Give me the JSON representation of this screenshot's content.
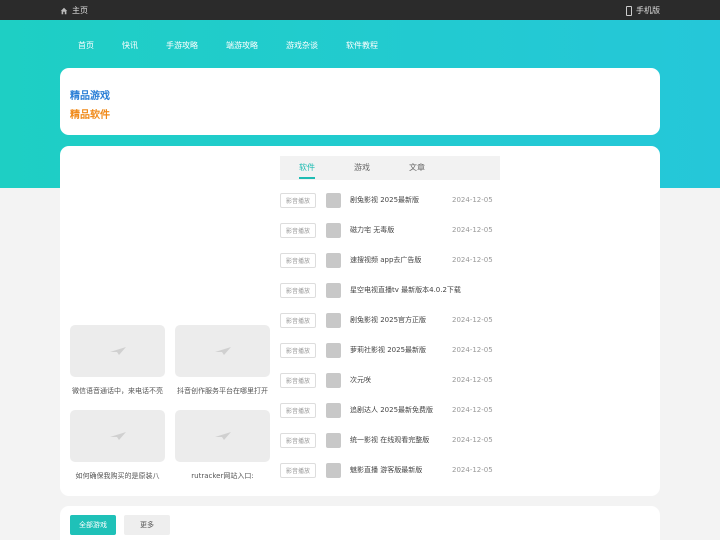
{
  "topbar": {
    "home": "主页",
    "mobile": "手机版"
  },
  "nav": [
    "首页",
    "快讯",
    "手游攻略",
    "端游攻略",
    "游戏杂谈",
    "软件教程"
  ],
  "categories": {
    "games": "精品游戏",
    "software": "精品软件"
  },
  "thumbs": [
    {
      "caption": "微信语音通话中，来电话不亮"
    },
    {
      "caption": "抖音创作服务平台在哪里打开"
    },
    {
      "caption": "如何确保我购买的是原装八"
    },
    {
      "caption": "rutracker网站入口:"
    }
  ],
  "tabs": {
    "software": "软件",
    "games": "游戏",
    "articles": "文章"
  },
  "list": [
    {
      "badge": "影音播放",
      "title": "剧兔影视 2025最新版",
      "date": "2024-12-05"
    },
    {
      "badge": "影音播放",
      "title": "磁力宅 无毒版",
      "date": "2024-12-05"
    },
    {
      "badge": "影音播放",
      "title": "速搜视频 app去广告版",
      "date": "2024-12-05"
    },
    {
      "badge": "影音播放",
      "title": "星空电视直播tv 最新版本4.0.2下载",
      "date": ""
    },
    {
      "badge": "影音播放",
      "title": "剧兔影视 2025官方正版",
      "date": "2024-12-05"
    },
    {
      "badge": "影音播放",
      "title": "萝莉社影视 2025最新版",
      "date": "2024-12-05"
    },
    {
      "badge": "影音播放",
      "title": "次元咲",
      "date": "2024-12-05"
    },
    {
      "badge": "影音播放",
      "title": "追剧达人 2025最新免费版",
      "date": "2024-12-05"
    },
    {
      "badge": "影音播放",
      "title": "统一影视 在线观看完整版",
      "date": "2024-12-05"
    },
    {
      "badge": "影音播放",
      "title": "魅影直播 游客版最新版",
      "date": "2024-12-05"
    }
  ],
  "bottom": {
    "all_games": "全部游戏",
    "more": "更多"
  },
  "colors": {
    "accent": "#1fbcb3",
    "games_label": "#2b7fd6",
    "software_label": "#f08a1a"
  }
}
